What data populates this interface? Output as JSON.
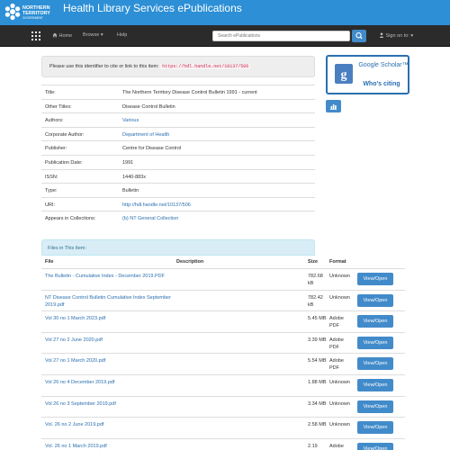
{
  "banner": {
    "logo_text": "NORTHERN TERRITORY GOVERNMENT",
    "title": "Health Library Services ePublications"
  },
  "nav": {
    "home": "Home",
    "browse": "Browse ▾",
    "help": "Help",
    "search_placeholder": "Search ePublications",
    "signin": "Sign on to: ▾"
  },
  "cite": {
    "text": "Please use this identifier to cite or link to this item:",
    "handle": "https://hdl.handle.net/10137/506"
  },
  "metadata": [
    {
      "key": "Title:",
      "value": "The Northern Territory Disease Control Bulletin 1991 - current",
      "link": false
    },
    {
      "key": "Other Titles:",
      "value": "Disease Control Bulletin",
      "link": false
    },
    {
      "key": "Authors:",
      "value": "Various",
      "link": true
    },
    {
      "key": "Corporate Author:",
      "value": "Department of Health",
      "link": true
    },
    {
      "key": "Publisher:",
      "value": "Centre for Disease Control",
      "link": false
    },
    {
      "key": "Publication Date:",
      "value": "1991",
      "link": false
    },
    {
      "key": "ISSN:",
      "value": "1440-883x",
      "link": false
    },
    {
      "key": "Type:",
      "value": "Bulletin",
      "link": false
    },
    {
      "key": "URI:",
      "value": "http://hdl.handle.net/10137/506",
      "link": true
    },
    {
      "key": "Appears in Collections:",
      "value": "(b) NT General Collection",
      "link": true
    }
  ],
  "files": {
    "header": "Files in This Item:",
    "columns": {
      "file": "File",
      "description": "Description",
      "size": "Size",
      "format": "Format"
    },
    "view_label": "View/Open",
    "rows": [
      {
        "name": "The Bulletin - Cumulative Index - December 2019.PDF",
        "size": "782.68 kB",
        "format": "Unknown"
      },
      {
        "name": "NT Disease Control Bulletin Cumulative Index September 2019.pdf",
        "size": "782.42 kB",
        "format": "Unknown"
      },
      {
        "name": "Vol 30 no 1 March 2023.pdf",
        "size": "5.45 MB",
        "format": "Adobe PDF"
      },
      {
        "name": "Vol 27 no 2 June 2020.pdf",
        "size": "3.39 MB",
        "format": "Adobe PDF"
      },
      {
        "name": "Vol 27 no 1 March 2020.pdf",
        "size": "5.54 MB",
        "format": "Adobe PDF"
      },
      {
        "name": "Vol 26 no 4 December 2019.pdf",
        "size": "1.88 MB",
        "format": "Unknown"
      },
      {
        "name": "Vol 26 no 3 September 2019.pdf",
        "size": "3.34 MB",
        "format": "Unknown"
      },
      {
        "name": "Vol. 26 no 2 June 2019.pdf",
        "size": "2.58 MB",
        "format": "Unknown"
      },
      {
        "name": "Vol. 26 no 1 March 2019.pdf",
        "size": "2.19",
        "format": "Adobe"
      }
    ]
  },
  "sidebar": {
    "scholar_name": "Google Scholar™",
    "scholar_sub": "Who's citing"
  },
  "colors": {
    "banner": "#2d8fd5",
    "navbar": "#2b2b2b",
    "button": "#428bca",
    "link": "#2a6fb0",
    "panel_heading": "#d9edf7"
  }
}
